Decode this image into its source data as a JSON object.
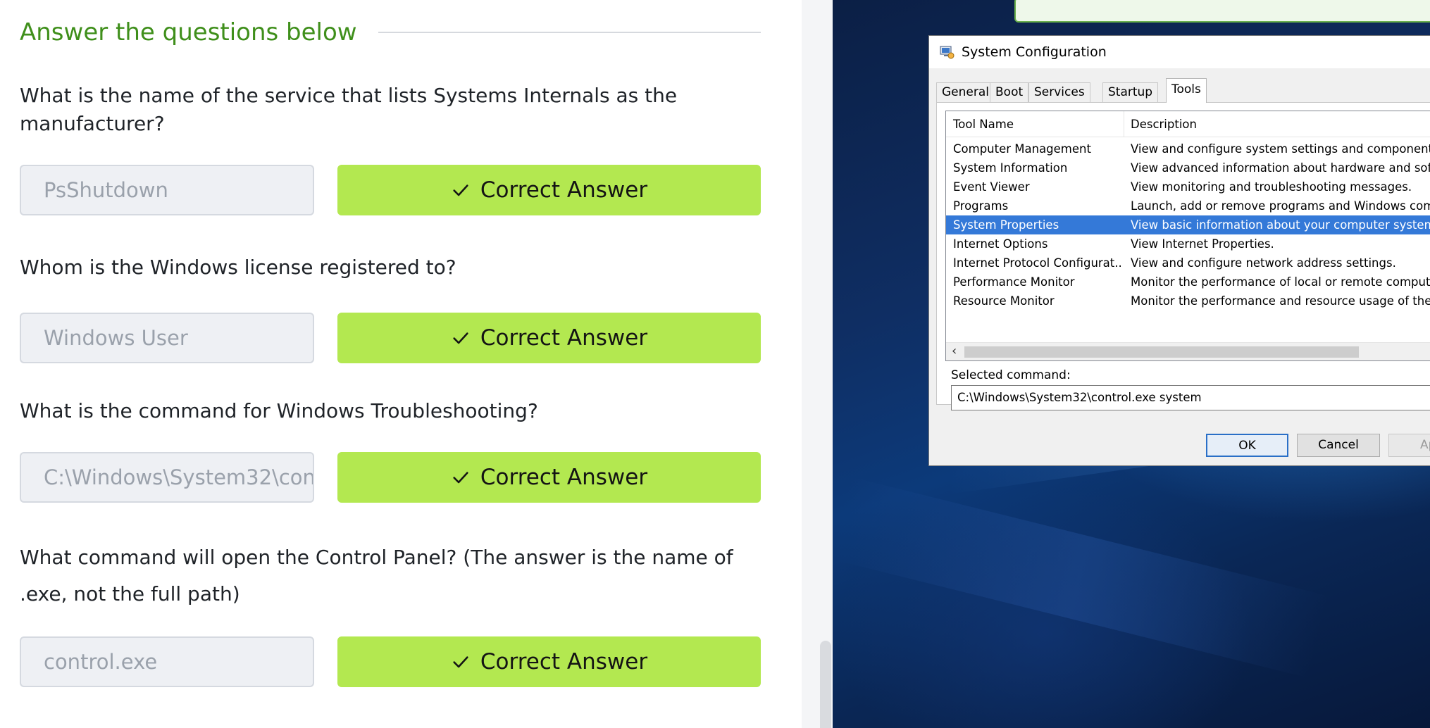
{
  "section": {
    "title": "Answer the questions below"
  },
  "questions": [
    {
      "text": "What is the name of the service that lists Systems Internals as the manufacturer?",
      "answer": "PsShutdown",
      "status": "Correct Answer"
    },
    {
      "text": "Whom is the Windows license registered to?",
      "answer": "Windows User",
      "status": "Correct Answer"
    },
    {
      "text": "What is the command for Windows Troubleshooting?",
      "answer": "C:\\Windows\\System32\\con",
      "status": "Correct Answer"
    },
    {
      "text": "What command will open the Control Panel? (The answer is  the name of .exe, not the full path)",
      "answer": "control.exe",
      "status": "Correct Answer"
    }
  ],
  "dialog": {
    "title": "System Configuration",
    "tabs": [
      "General",
      "Boot",
      "Services",
      "Startup",
      "Tools"
    ],
    "active_tab": "Tools",
    "columns": {
      "name": "Tool Name",
      "description": "Description"
    },
    "rows": [
      {
        "name": "Computer Management",
        "description": "View and configure system settings and components."
      },
      {
        "name": "System Information",
        "description": "View advanced information about hardware and softw"
      },
      {
        "name": "Event Viewer",
        "description": "View monitoring and troubleshooting messages."
      },
      {
        "name": "Programs",
        "description": "Launch, add or remove programs and Windows compo"
      },
      {
        "name": "System Properties",
        "description": "View basic information about your computer system se"
      },
      {
        "name": "Internet Options",
        "description": "View Internet Properties."
      },
      {
        "name": "Internet Protocol Configurat...",
        "description": "View and configure network address settings."
      },
      {
        "name": "Performance Monitor",
        "description": "Monitor the performance of local or remote computers"
      },
      {
        "name": "Resource Monitor",
        "description": "Monitor the performance and resource usage of the lo"
      }
    ],
    "selected_row": "System Properties",
    "selected_command_label": "Selected command:",
    "selected_command": "C:\\Windows\\System32\\control.exe system",
    "buttons": {
      "ok": "OK",
      "cancel": "Cancel",
      "apply": "App"
    }
  },
  "colors": {
    "accent_green_text": "#3f8f1b",
    "correct_button": "#b3e850",
    "selection_blue": "#3479d8"
  },
  "icons": {
    "check": "check-icon",
    "app": "system-configuration-icon",
    "scroll_left": "chevron-left-icon"
  }
}
